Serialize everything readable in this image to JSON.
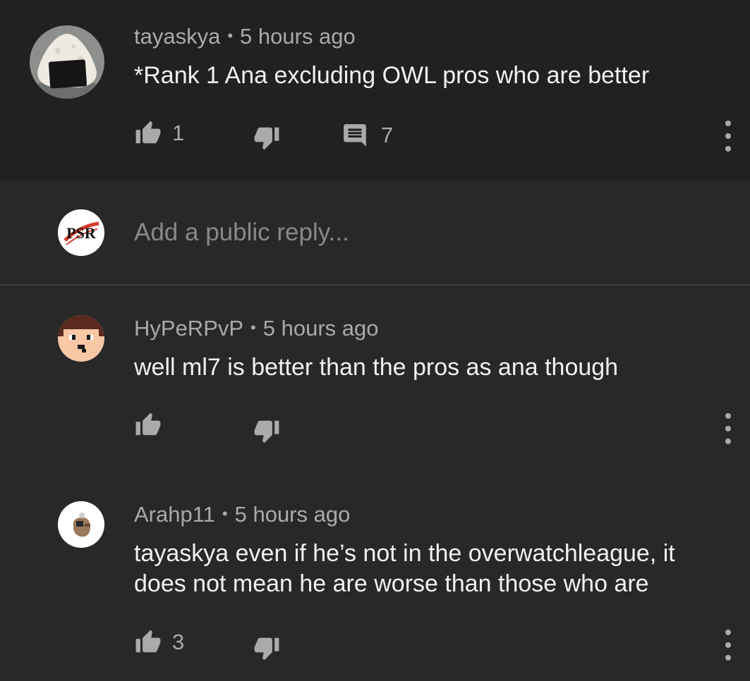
{
  "top_comment": {
    "author": "tayaskya",
    "separator": "•",
    "time": "5 hours ago",
    "text": "*Rank 1 Ana excluding OWL pros who are better",
    "likes": "1",
    "replies": "7"
  },
  "reply_box": {
    "avatar_text": "PSR",
    "placeholder": "Add a public reply..."
  },
  "replies": [
    {
      "author": "HyPeRPvP",
      "separator": "•",
      "time": "5 hours ago",
      "text": "well ml7 is better than the pros as ana though",
      "likes": ""
    },
    {
      "author": "Arahp11",
      "separator": "•",
      "time": "5 hours ago",
      "text_line1": "tayaskya even if he’s not in the overwatchleague, it",
      "text_line2": "does not mean he are worse than those who are",
      "likes": "3"
    }
  ],
  "colors": {
    "background": "#282828",
    "top_comment_background": "#212121",
    "secondary_text": "#aaaaaa",
    "primary_text": "#f1f1f1"
  }
}
